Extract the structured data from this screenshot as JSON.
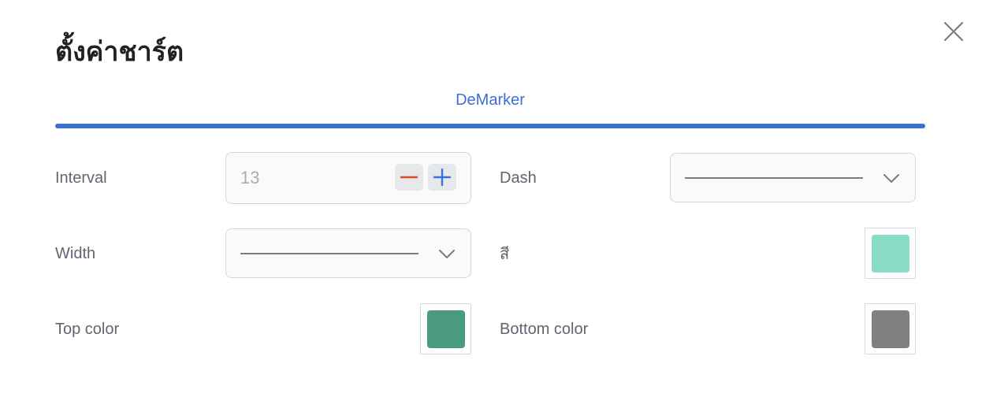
{
  "dialog": {
    "title": "ตั้งค่าชาร์ต",
    "close_icon": "close-icon"
  },
  "tabs": [
    {
      "label": "DeMarker",
      "active": true
    }
  ],
  "settings": {
    "interval": {
      "label": "Interval",
      "value": "13",
      "decrement_icon": "minus-icon",
      "increment_icon": "plus-icon"
    },
    "dash": {
      "label": "Dash",
      "preview": "solid-line",
      "dropdown_icon": "chevron-down-icon"
    },
    "width": {
      "label": "Width",
      "preview": "thin-line",
      "dropdown_icon": "chevron-down-icon"
    },
    "color": {
      "label": "สี",
      "value": "#8adcc6"
    },
    "top_color": {
      "label": "Top color",
      "value": "#4a9a80"
    },
    "bottom_color": {
      "label": "Bottom color",
      "value": "#808080"
    }
  },
  "colors": {
    "accent": "#3b6fd8",
    "minus": "#d9482b",
    "plus": "#3b6fd8",
    "label_text": "#5e6673",
    "title_text": "#222222"
  }
}
